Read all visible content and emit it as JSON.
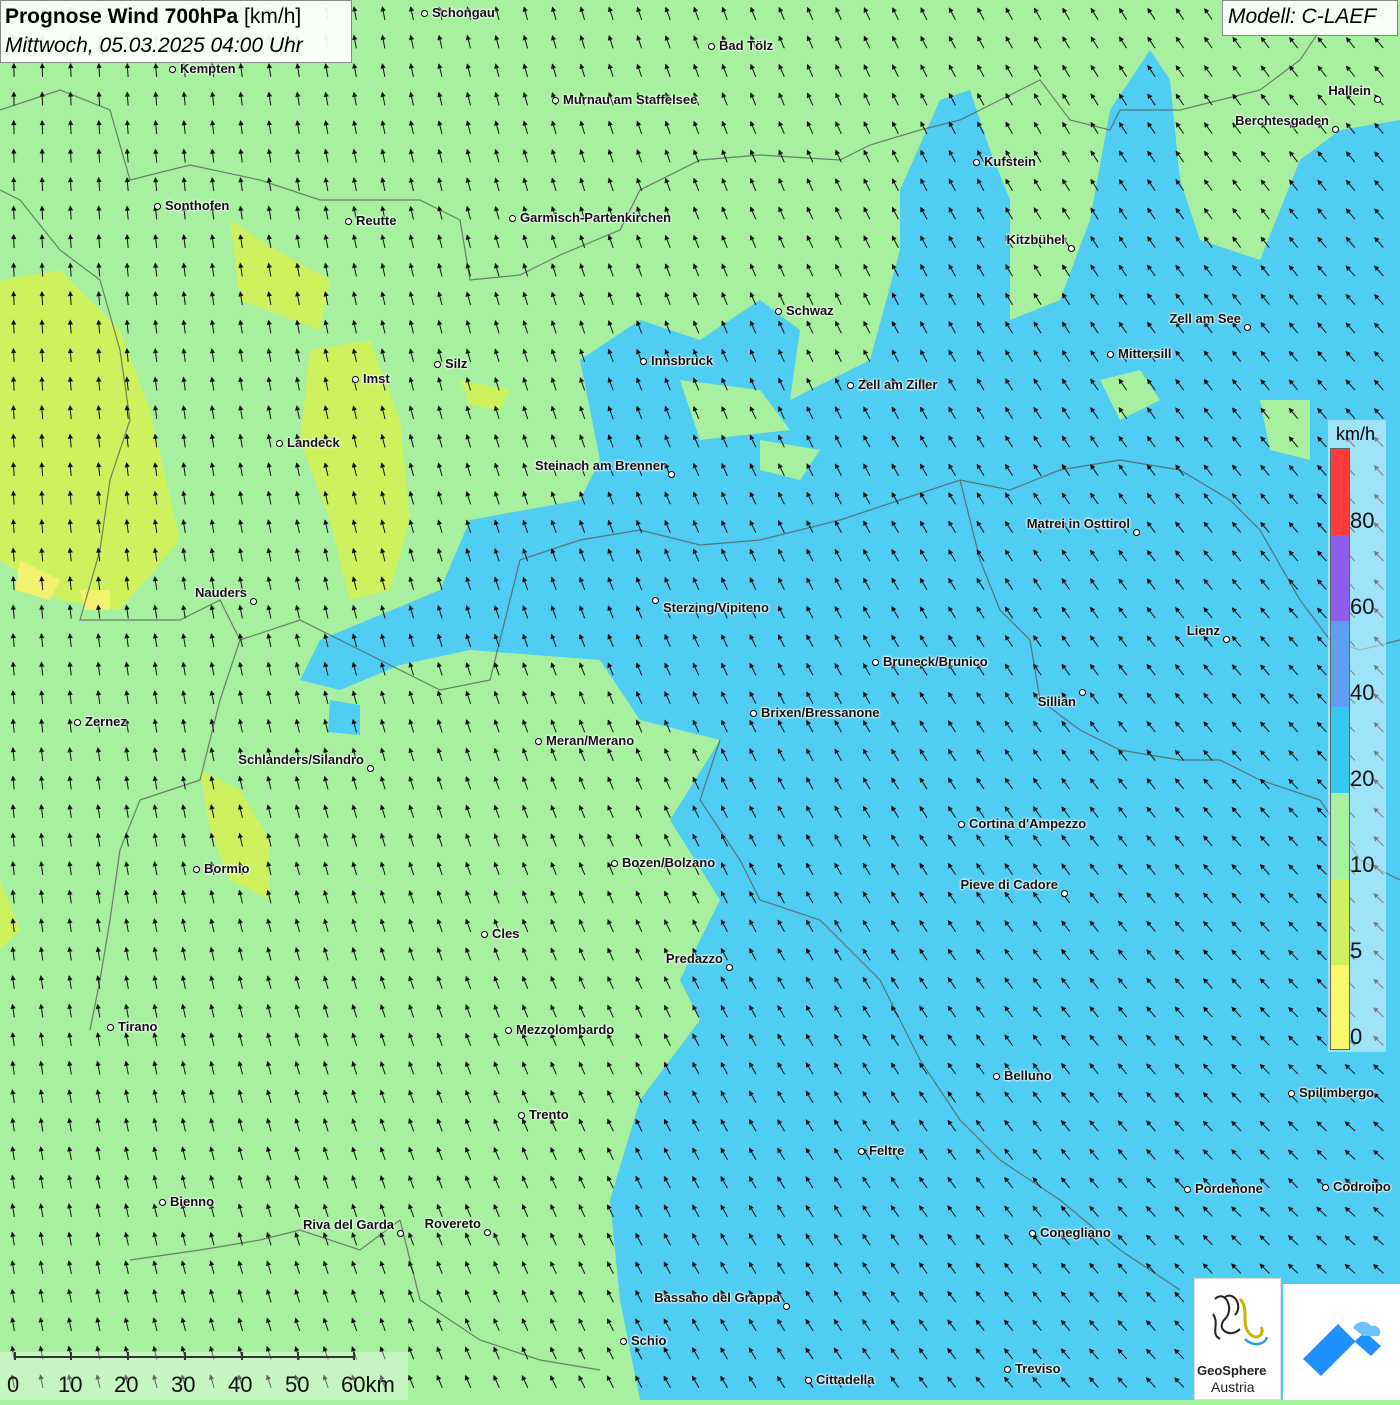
{
  "title": {
    "main": "Prognose Wind 700hPa",
    "unit": "[km/h]",
    "datetime": "Mittwoch, 05.03.2025 04:00 Uhr"
  },
  "model": "Modell: C-LAEF",
  "legend": {
    "unit": "km/h",
    "ticks": [
      "80",
      "60",
      "40",
      "20",
      "10",
      "5",
      "0"
    ],
    "colors": [
      "#ff3b3b",
      "#8f5cf0",
      "#5d9ff5",
      "#35c9f0",
      "#a6f0a0",
      "#cdf25e",
      "#f8f868"
    ]
  },
  "scale_bar": {
    "labels": [
      "0",
      "10",
      "20",
      "30",
      "40",
      "50",
      "60km"
    ]
  },
  "logo": {
    "name": "GeoSphere",
    "sub": "Austria"
  },
  "places": [
    {
      "name": "Schongau"
    },
    {
      "name": "Bad Tölz"
    },
    {
      "name": "Kempten"
    },
    {
      "name": "Murnau am Staffelsee"
    },
    {
      "name": "Hallein"
    },
    {
      "name": "Berchtesgaden"
    },
    {
      "name": "Kufstein"
    },
    {
      "name": "Sonthofen"
    },
    {
      "name": "Reutte"
    },
    {
      "name": "Garmisch-Partenkirchen"
    },
    {
      "name": "Kitzbühel"
    },
    {
      "name": "Schwaz"
    },
    {
      "name": "Zell am See"
    },
    {
      "name": "Innsbruck"
    },
    {
      "name": "Mittersill"
    },
    {
      "name": "Silz"
    },
    {
      "name": "Imst"
    },
    {
      "name": "Zell am Ziller"
    },
    {
      "name": "Landeck"
    },
    {
      "name": "Steinach am Brenner"
    },
    {
      "name": "Matrei in Osttirol"
    },
    {
      "name": "Nauders"
    },
    {
      "name": "Sterzing/Vipiteno"
    },
    {
      "name": "Lienz"
    },
    {
      "name": "Bruneck/Brunico"
    },
    {
      "name": "Sillian"
    },
    {
      "name": "Zernez"
    },
    {
      "name": "Brixen/Bressanone"
    },
    {
      "name": "Meran/Merano"
    },
    {
      "name": "Schlanders/Silandro"
    },
    {
      "name": "Cortina d'Ampezzo"
    },
    {
      "name": "Bozen/Bolzano"
    },
    {
      "name": "Bormio"
    },
    {
      "name": "Pieve di Cadore"
    },
    {
      "name": "Cles"
    },
    {
      "name": "Predazzo"
    },
    {
      "name": "Tirano"
    },
    {
      "name": "Mezzolombardo"
    },
    {
      "name": "Belluno"
    },
    {
      "name": "Spilimbergo"
    },
    {
      "name": "Trento"
    },
    {
      "name": "Feltre"
    },
    {
      "name": "Pordenone"
    },
    {
      "name": "Codroipo"
    },
    {
      "name": "Bienno"
    },
    {
      "name": "Riva del Garda"
    },
    {
      "name": "Rovereto"
    },
    {
      "name": "Conegliano"
    },
    {
      "name": "Bassano del Grappa"
    },
    {
      "name": "Schio"
    },
    {
      "name": "Treviso"
    },
    {
      "name": "Cittadella"
    }
  ]
}
